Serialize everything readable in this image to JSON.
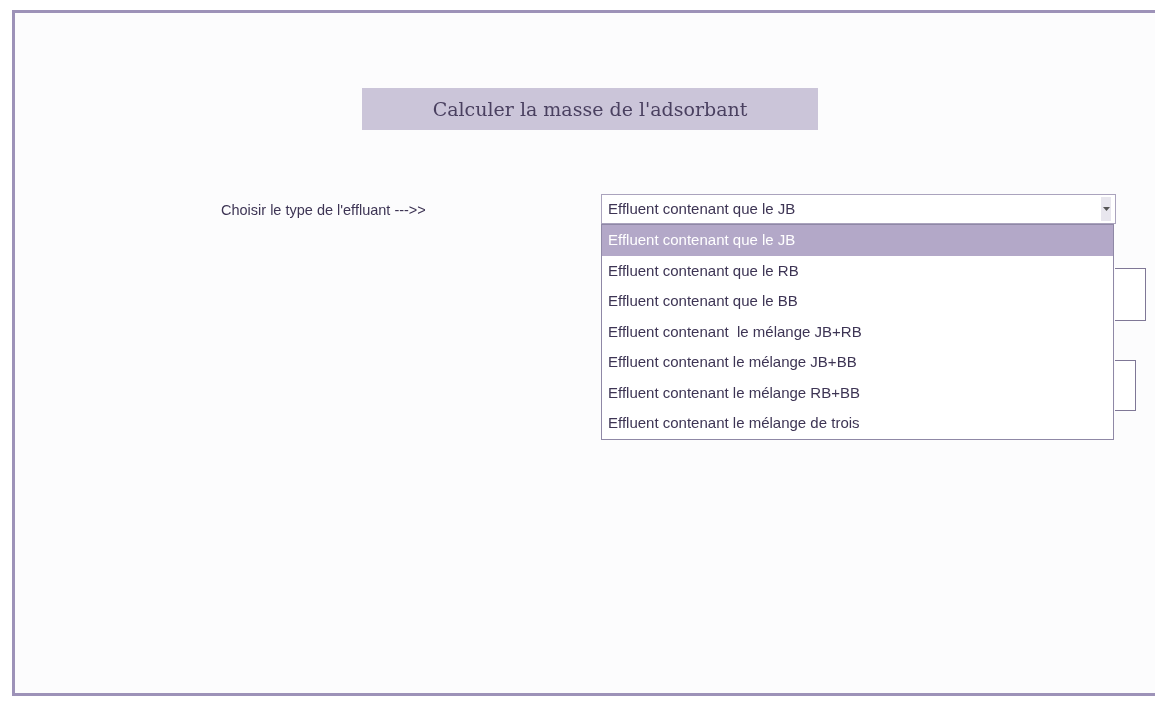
{
  "title": "Calculer la masse de l'adsorbant",
  "effluent": {
    "label": "Choisir le type de l'effluant --->>",
    "value": "Effluent contenant que le JB",
    "expanded": true,
    "options": [
      {
        "label": "Effluent contenant que le JB",
        "selected": true
      },
      {
        "label": "Effluent contenant que le RB",
        "selected": false
      },
      {
        "label": "Effluent contenant que le BB",
        "selected": false
      },
      {
        "label": "Effluent contenant  le mélange JB+RB",
        "selected": false
      },
      {
        "label": "Effluent contenant le mélange JB+BB",
        "selected": false
      },
      {
        "label": "Effluent contenant le mélange RB+BB",
        "selected": false
      },
      {
        "label": "Effluent contenant le mélange de trois",
        "selected": false
      }
    ]
  }
}
